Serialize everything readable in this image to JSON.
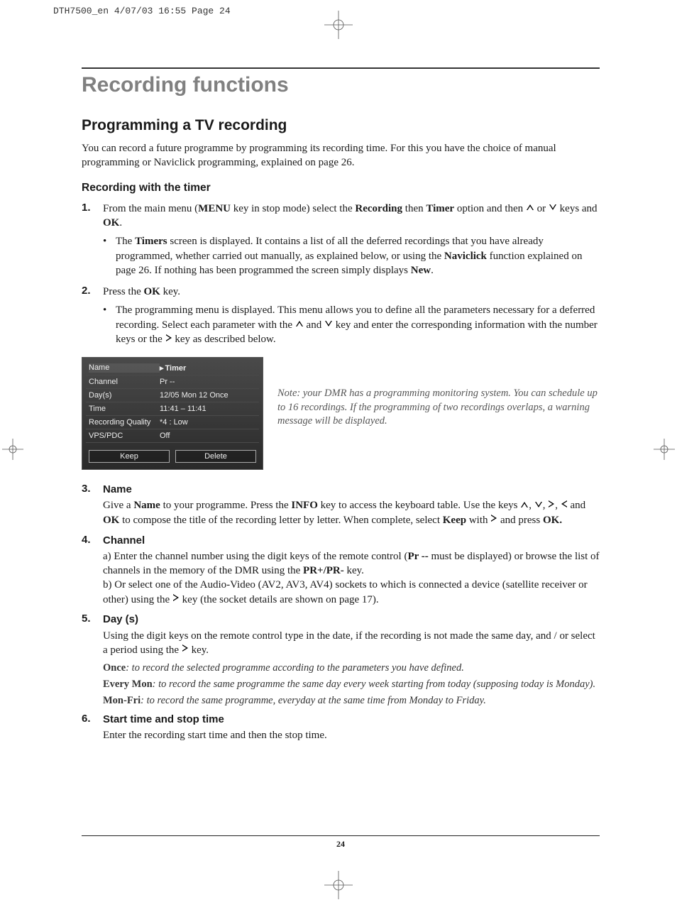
{
  "meta": {
    "header": "DTH7500_en  4/07/03  16:55  Page 24",
    "pagenum": "24"
  },
  "title": "Recording functions",
  "subtitle": "Programming a TV recording",
  "intro": "You can record a future programme by programming its recording time. For this you have the choice of manual programming or Naviclick programming, explained on page 26.",
  "subheading": "Recording with the timer",
  "step1": {
    "pre": "From the main menu (",
    "menu": "MENU",
    "mid1": " key in stop mode) select the ",
    "recording": "Recording",
    "mid2": " then ",
    "timer": "Timer",
    "mid3": " option and then ",
    "mid4": " or ",
    "mid5": " keys and ",
    "ok": "OK",
    "end": ".",
    "bullet_pre": "The ",
    "timers": "Timers",
    "bullet_mid": " screen is displayed. It contains a list of all the deferred recordings that you have already programmed, whether carried out manually, as explained below, or using the ",
    "naviclick": "Naviclick",
    "bullet_mid2": " function explained on page 26. If nothing has been programmed the screen simply displays ",
    "new": "New",
    "bullet_end": "."
  },
  "step2": {
    "pre": "Press the ",
    "ok": "OK",
    "end": " key.",
    "bullet_pre": "The programming menu is displayed. This menu allows you to define all the parameters necessary for a deferred recording. Select each parameter with the ",
    "bullet_mid1": " and ",
    "bullet_mid2": " key and enter the corresponding information with the number keys or the ",
    "bullet_end": " key as described below."
  },
  "figure": {
    "rows": [
      {
        "label": "Name",
        "value": "Timer"
      },
      {
        "label": "Channel",
        "value": "Pr --"
      },
      {
        "label": "Day(s)",
        "value": "12/05  Mon 12  Once"
      },
      {
        "label": "Time",
        "value": "11:41  –   11:41"
      },
      {
        "label": "Recording Quality",
        "value": "*4 : Low"
      },
      {
        "label": "VPS/PDC",
        "value": "Off"
      }
    ],
    "keep": "Keep",
    "delete": "Delete"
  },
  "note": "Note: your DMR has a programming monitoring system. You can schedule up to 16 recordings. If the programming of two recordings overlaps, a warning message will be displayed.",
  "step3": {
    "heading": "Name",
    "pre": "Give a ",
    "name": "Name",
    "mid1": " to your programme. Press the ",
    "info": "INFO",
    "mid2": " key to access the keyboard table. Use the keys ",
    "mid3": ", ",
    "mid4": " and ",
    "ok": "OK",
    "mid5": " to compose the title of the recording letter by letter. When complete, select ",
    "keep": "Keep",
    "mid6": " with ",
    "mid7": " and press ",
    "ok2": "OK."
  },
  "step4": {
    "heading": "Channel",
    "a": "a) Enter the channel number using the digit keys of the remote control (",
    "pr": "Pr --",
    "a2": " must be displayed) or browse the list of channels in the memory of the DMR using the ",
    "prplus": "PR+/PR-",
    "a3": " key.",
    "b": "b) Or select one of the Audio-Video (AV2, AV3, AV4) sockets to which is connected a device (satellite receiver or other) using the ",
    "b2": " key (the socket details are shown on page 17)."
  },
  "step5": {
    "heading": "Day (s)",
    "text": "Using the digit keys on the remote control type in the date, if the recording is not made the same day, and / or select a period using the ",
    "text2": " key.",
    "once_label": "Once",
    "once_def": ": to record the selected programme according to the parameters you have defined.",
    "mon_label": "Every Mon",
    "mon_def": ": to record the same programme the same day every week starting from today (supposing today is Monday).",
    "monfri_label": "Mon-Fri",
    "monfri_def": ": to record the same programme, everyday at the same time from Monday to Friday."
  },
  "step6": {
    "heading": "Start time and stop time",
    "text": "Enter the recording start time and then the stop time."
  }
}
